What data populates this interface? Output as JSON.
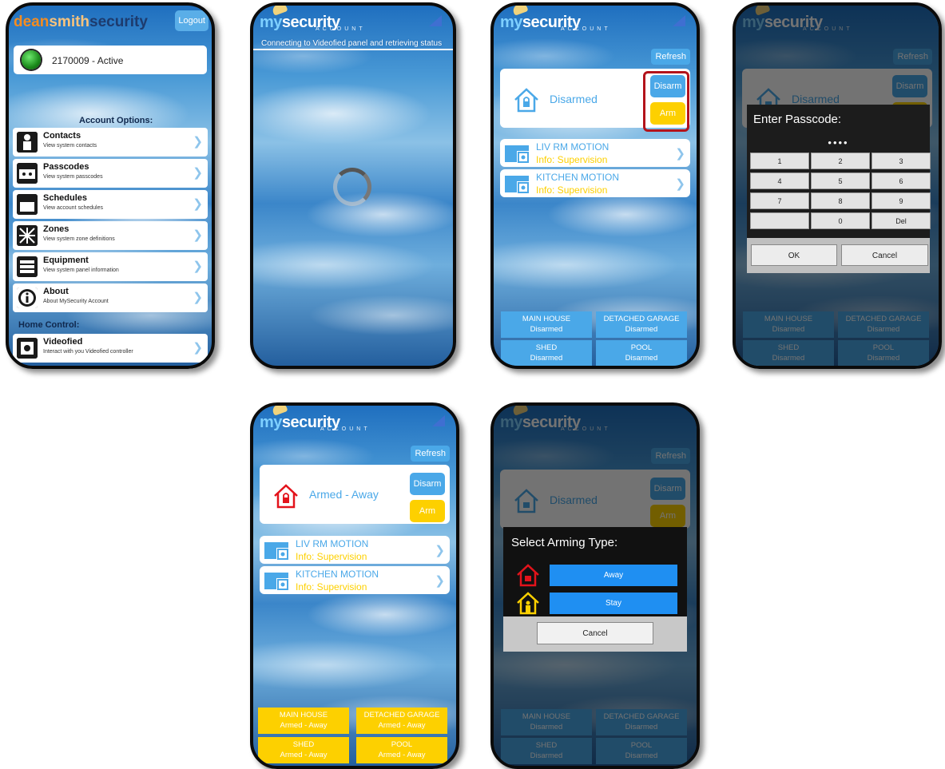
{
  "phone1": {
    "brand": {
      "part1": "dean",
      "part2": "smith",
      "part3": "security"
    },
    "logout_label": "Logout",
    "account": "2170009 - Active",
    "account_options_label": "Account Options:",
    "menu": [
      {
        "title": "Contacts",
        "subtitle": "View system contacts"
      },
      {
        "title": "Passcodes",
        "subtitle": "View system passcodes"
      },
      {
        "title": "Schedules",
        "subtitle": "View account schedules"
      },
      {
        "title": "Zones",
        "subtitle": "View system zone definitions"
      },
      {
        "title": "Equipment",
        "subtitle": "View system panel information"
      },
      {
        "title": "About",
        "subtitle": "About MySecurity Account"
      }
    ],
    "home_control_label": "Home Control:",
    "videofied": {
      "title": "Videofied",
      "subtitle": "Interact with you Videofied controller"
    }
  },
  "logo": {
    "my": "my",
    "security": "security",
    "account": "ACCOUNT"
  },
  "phone2": {
    "status": "Connecting to Videofied  panel and retrieving status"
  },
  "refresh_label": "Refresh",
  "disarm_label": "Disarm",
  "arm_label": "Arm",
  "state_disarmed": "Disarmed",
  "state_armed_away": "Armed - Away",
  "sensors": [
    {
      "name": "LIV RM MOTION",
      "info": "Info: Supervision"
    },
    {
      "name": "KITCHEN MOTION",
      "info": "Info: Supervision"
    }
  ],
  "zones": [
    "MAIN HOUSE",
    "DETACHED GARAGE",
    "SHED",
    "POOL"
  ],
  "passcode": {
    "title": "Enter Passcode:",
    "dots": "••••",
    "keys": [
      "1",
      "2",
      "3",
      "4",
      "5",
      "6",
      "7",
      "8",
      "9",
      "",
      "0",
      "Del"
    ],
    "ok": "OK",
    "cancel": "Cancel"
  },
  "arming": {
    "title": "Select Arming Type:",
    "away": "Away",
    "stay": "Stay",
    "cancel": "Cancel"
  },
  "colors": {
    "accent_blue": "#4aa8e8",
    "arm_yellow": "#fdd000",
    "armed_red": "#e3131b",
    "highlight": "#b3131b"
  }
}
